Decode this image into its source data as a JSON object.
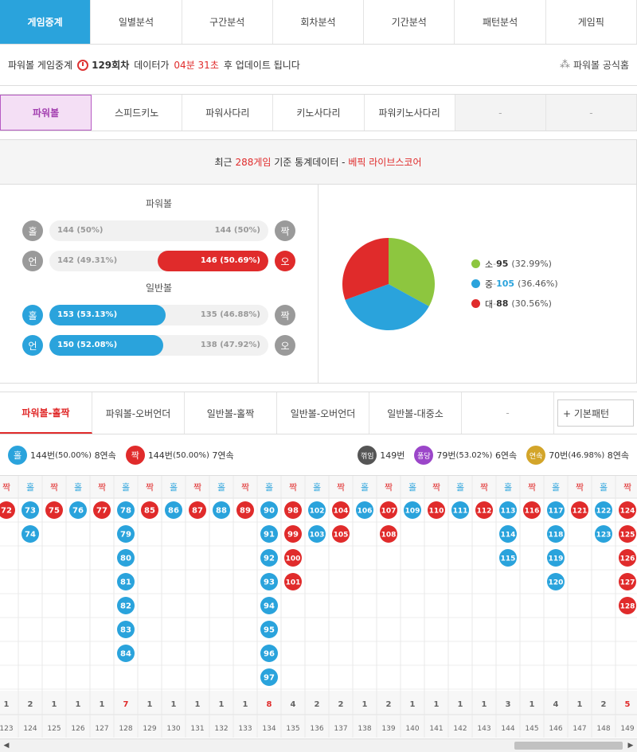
{
  "top_tabs": [
    "게임중계",
    "일별분석",
    "구간분석",
    "회차분석",
    "기간분석",
    "패턴분석",
    "게임픽"
  ],
  "info": {
    "prefix": "파워볼 게임중계",
    "round": "129회차",
    "mid": "데이터가",
    "time": "04분 31초",
    "suffix": "후 업데이트 됩니다",
    "official": "파워볼 공식홈"
  },
  "sub_tabs": [
    "파워볼",
    "스피드키노",
    "파워사다리",
    "키노사다리",
    "파워키노사다리",
    "-",
    "-"
  ],
  "stats_header": {
    "a": "최근",
    "b": "288게임",
    "c": "기준 통계데이터 -",
    "d": "베픽 라이브스코어"
  },
  "powerball_title": "파워볼",
  "normal_title": "일반볼",
  "bars": [
    {
      "left_icon": "홀",
      "right_icon": "짝",
      "left_text": "144 (50%)",
      "right_text": "144 (50%)",
      "left_pct": 0,
      "right_pct": 0
    },
    {
      "left_icon": "언",
      "right_icon": "오",
      "left_text": "142 (49.31%)",
      "right_text": "146 (50.69%)",
      "left_pct": 0,
      "right_pct": 50.69
    },
    {
      "left_icon": "홀",
      "right_icon": "짝",
      "left_text": "153 (53.13%)",
      "right_text": "135 (46.88%)",
      "left_pct": 53.13,
      "right_pct": 0
    },
    {
      "left_icon": "언",
      "right_icon": "오",
      "left_text": "150 (52.08%)",
      "right_text": "138 (47.92%)",
      "left_pct": 52.08,
      "right_pct": 0
    }
  ],
  "pie": [
    {
      "label": "소",
      "count": "95",
      "pct": "(32.99%)",
      "value": 32.99,
      "color": "#8dc63f"
    },
    {
      "label": "중",
      "count": "105",
      "pct": "(36.46%)",
      "value": 36.46,
      "color": "#2aa3dc"
    },
    {
      "label": "대",
      "count": "88",
      "pct": "(30.56%)",
      "value": 30.56,
      "color": "#e02b2b"
    }
  ],
  "pattern_tabs": [
    "파워볼-홀짝",
    "파워볼-오버언더",
    "일반볼-홀짝",
    "일반볼-오버언더",
    "일반볼-대중소",
    "-"
  ],
  "pattern_button": "+ 기본패턴",
  "summary": {
    "odd_icon": "홀",
    "odd_count": "144번",
    "odd_pct": "(50.00%)",
    "odd_streak": "8연속",
    "even_icon": "짝",
    "even_count": "144번",
    "even_pct": "(50.00%)",
    "even_streak": "7연속",
    "k_icon": "꺾임",
    "k_count": "149번",
    "p_icon": "퐁당",
    "p_count": "79번",
    "p_pct": "(53.02%)",
    "p_streak": "6연속",
    "y_icon": "연속",
    "y_count": "70번",
    "y_pct": "(46.98%)",
    "y_streak": "8연속"
  },
  "columns": [
    {
      "h": "짝",
      "c": "even",
      "n": [
        72
      ],
      "len": "1",
      "ix": "123"
    },
    {
      "h": "홀",
      "c": "odd",
      "n": [
        73,
        74
      ],
      "len": "2",
      "ix": "124"
    },
    {
      "h": "짝",
      "c": "even",
      "n": [
        75
      ],
      "len": "1",
      "ix": "125"
    },
    {
      "h": "홀",
      "c": "odd",
      "n": [
        76
      ],
      "len": "1",
      "ix": "126"
    },
    {
      "h": "짝",
      "c": "even",
      "n": [
        77
      ],
      "len": "1",
      "ix": "127"
    },
    {
      "h": "홀",
      "c": "odd",
      "n": [
        78,
        79,
        80,
        81,
        82,
        83,
        84
      ],
      "len": "7",
      "ix": "128"
    },
    {
      "h": "짝",
      "c": "even",
      "n": [
        85
      ],
      "len": "1",
      "ix": "129"
    },
    {
      "h": "홀",
      "c": "odd",
      "n": [
        86
      ],
      "len": "1",
      "ix": "130"
    },
    {
      "h": "짝",
      "c": "even",
      "n": [
        87
      ],
      "len": "1",
      "ix": "131"
    },
    {
      "h": "홀",
      "c": "odd",
      "n": [
        88
      ],
      "len": "1",
      "ix": "132"
    },
    {
      "h": "짝",
      "c": "even",
      "n": [
        89
      ],
      "len": "1",
      "ix": "133"
    },
    {
      "h": "홀",
      "c": "odd",
      "n": [
        90,
        91,
        92,
        93,
        94,
        95,
        96,
        97
      ],
      "len": "8",
      "ix": "134"
    },
    {
      "h": "짝",
      "c": "even",
      "n": [
        98,
        99,
        100,
        101
      ],
      "len": "4",
      "ix": "135"
    },
    {
      "h": "홀",
      "c": "odd",
      "n": [
        102,
        103
      ],
      "len": "2",
      "ix": "136"
    },
    {
      "h": "짝",
      "c": "even",
      "n": [
        104,
        105
      ],
      "len": "2",
      "ix": "137"
    },
    {
      "h": "홀",
      "c": "odd",
      "n": [
        106
      ],
      "len": "1",
      "ix": "138"
    },
    {
      "h": "짝",
      "c": "even",
      "n": [
        107,
        108
      ],
      "len": "2",
      "ix": "139"
    },
    {
      "h": "홀",
      "c": "odd",
      "n": [
        109
      ],
      "len": "1",
      "ix": "140"
    },
    {
      "h": "짝",
      "c": "even",
      "n": [
        110
      ],
      "len": "1",
      "ix": "141"
    },
    {
      "h": "홀",
      "c": "odd",
      "n": [
        111
      ],
      "len": "1",
      "ix": "142"
    },
    {
      "h": "짝",
      "c": "even",
      "n": [
        112
      ],
      "len": "1",
      "ix": "143"
    },
    {
      "h": "홀",
      "c": "odd",
      "n": [
        113,
        114,
        115
      ],
      "len": "3",
      "ix": "144"
    },
    {
      "h": "짝",
      "c": "even",
      "n": [
        116
      ],
      "len": "1",
      "ix": "145"
    },
    {
      "h": "홀",
      "c": "odd",
      "n": [
        117,
        118,
        119,
        120
      ],
      "len": "4",
      "ix": "146"
    },
    {
      "h": "짝",
      "c": "even",
      "n": [
        121
      ],
      "len": "1",
      "ix": "147"
    },
    {
      "h": "홀",
      "c": "odd",
      "n": [
        122,
        123
      ],
      "len": "2",
      "ix": "148"
    },
    {
      "h": "짝",
      "c": "even",
      "n": [
        124,
        125,
        126,
        127,
        128
      ],
      "len": "5",
      "ix": "149"
    }
  ],
  "highlight_lengths": [
    "7",
    "8",
    "5"
  ],
  "colors": {
    "odd": "#2aa3dc",
    "even": "#e02b2b",
    "accent": "#2aa3dc",
    "powerball_tab": "#a340b0"
  }
}
